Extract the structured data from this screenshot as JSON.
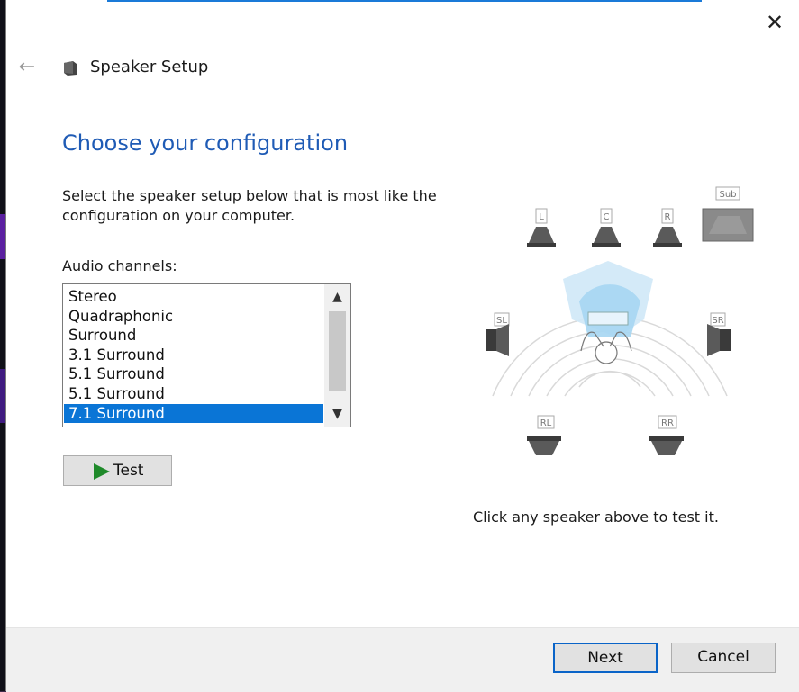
{
  "window": {
    "title": "Speaker Setup",
    "close_label": "✕",
    "back_label": "←"
  },
  "heading": "Choose your configuration",
  "description": "Select the speaker setup below that is most like the configuration on your computer.",
  "audio_channels": {
    "label": "Audio channels:",
    "items": [
      "Stereo",
      "Quadraphonic",
      "Surround",
      "3.1 Surround",
      "5.1 Surround",
      "5.1 Surround",
      "7.1 Surround"
    ],
    "selected": "7.1 Surround"
  },
  "test_button": {
    "label": "Test"
  },
  "speakers": {
    "front_left": "L",
    "center": "C",
    "front_right": "R",
    "subwoofer": "Sub",
    "side_left": "SL",
    "side_right": "SR",
    "rear_left": "RL",
    "rear_right": "RR"
  },
  "hint": "Click any speaker above to test it.",
  "footer": {
    "next_label": "Next",
    "cancel_label": "Cancel"
  },
  "colors": {
    "accent": "#1f5bb5",
    "selection": "#0a75d6",
    "play_icon": "#1f8a2a"
  }
}
